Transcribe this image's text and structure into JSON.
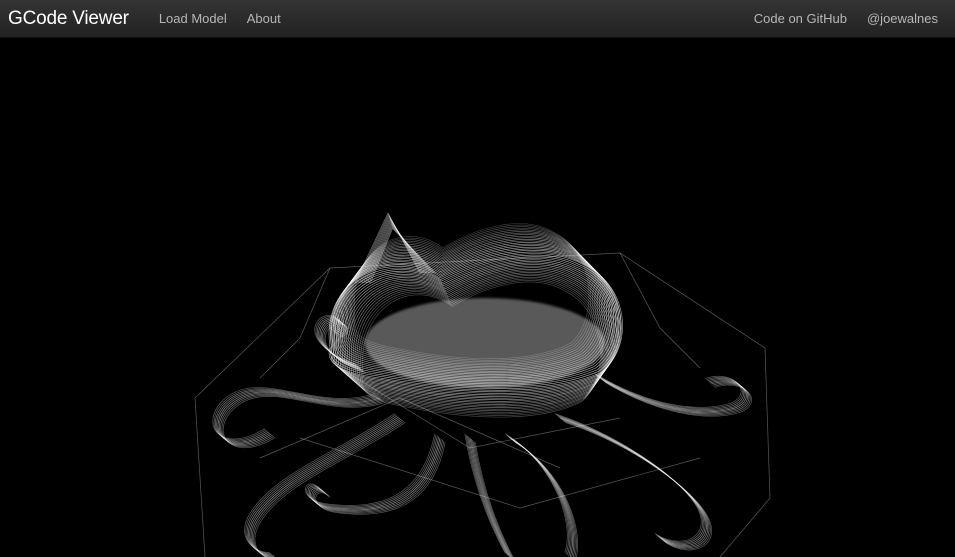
{
  "navbar": {
    "brand": "GCode Viewer",
    "links": [
      "Load Model",
      "About"
    ],
    "right_links": [
      "Code on GitHub",
      "@joewalnes"
    ]
  },
  "viewport": {
    "model_color": "#ffffff",
    "background_color": "#000000"
  }
}
